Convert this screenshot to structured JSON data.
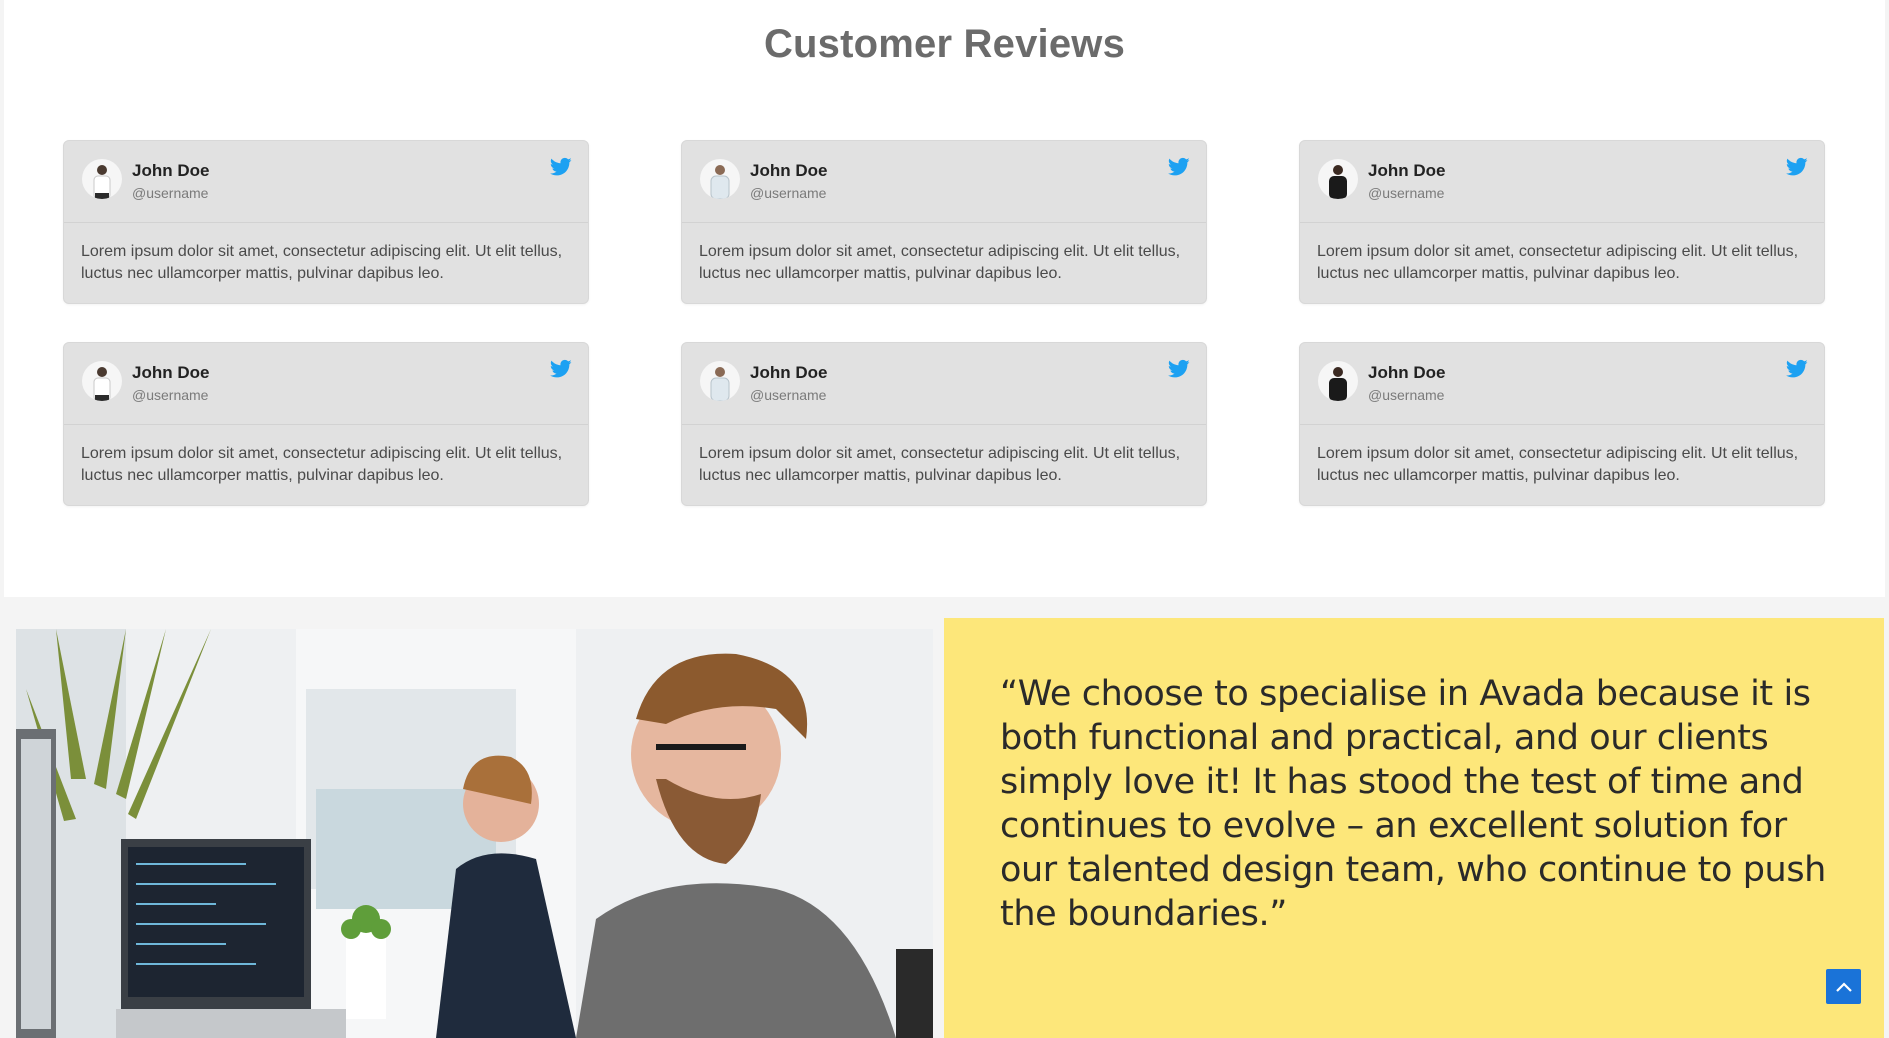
{
  "reviews": {
    "title": "Customer Reviews",
    "cards": [
      {
        "name": "John Doe",
        "handle": "@username",
        "text": "Lorem ipsum dolor sit amet, consectetur adipiscing elit. Ut elit tellus, luctus nec ullamcorper mattis, pulvinar dapibus leo.",
        "avatar": "person-white-shirt"
      },
      {
        "name": "John Doe",
        "handle": "@username",
        "text": "Lorem ipsum dolor sit amet, consectetur adipiscing elit. Ut elit tellus, luctus nec ullamcorper mattis, pulvinar dapibus leo.",
        "avatar": "person-light-tshirt"
      },
      {
        "name": "John Doe",
        "handle": "@username",
        "text": "Lorem ipsum dolor sit amet, consectetur adipiscing elit. Ut elit tellus, luctus nec ullamcorper mattis, pulvinar dapibus leo.",
        "avatar": "person-black-shirt"
      },
      {
        "name": "John Doe",
        "handle": "@username",
        "text": "Lorem ipsum dolor sit amet, consectetur adipiscing elit. Ut elit tellus, luctus nec ullamcorper mattis, pulvinar dapibus leo.",
        "avatar": "person-white-shirt"
      },
      {
        "name": "John Doe",
        "handle": "@username",
        "text": "Lorem ipsum dolor sit amet, consectetur adipiscing elit. Ut elit tellus, luctus nec ullamcorper mattis, pulvinar dapibus leo.",
        "avatar": "person-light-tshirt"
      },
      {
        "name": "John Doe",
        "handle": "@username",
        "text": "Lorem ipsum dolor sit amet, consectetur adipiscing elit. Ut elit tellus, luctus nec ullamcorper mattis, pulvinar dapibus leo.",
        "avatar": "person-black-shirt"
      }
    ],
    "icon": "twitter-icon",
    "colors": {
      "card_bg": "#e1e1e1",
      "twitter_blue": "#1da1f2",
      "title": "#6b6b6b"
    }
  },
  "testimonial": {
    "quote": "“We choose to specialise in Avada because it is both functional and practical, and our clients simply love it! It has stood the test of time and continues to evolve – an excellent solution for our talented design team, who continue to push the boundaries.”",
    "photo": "office-photo-developers-at-computers",
    "colors": {
      "panel_bg": "#fde77a"
    }
  },
  "scroll_top": {
    "icon": "chevron-up-icon",
    "color": "#1a73d8"
  }
}
